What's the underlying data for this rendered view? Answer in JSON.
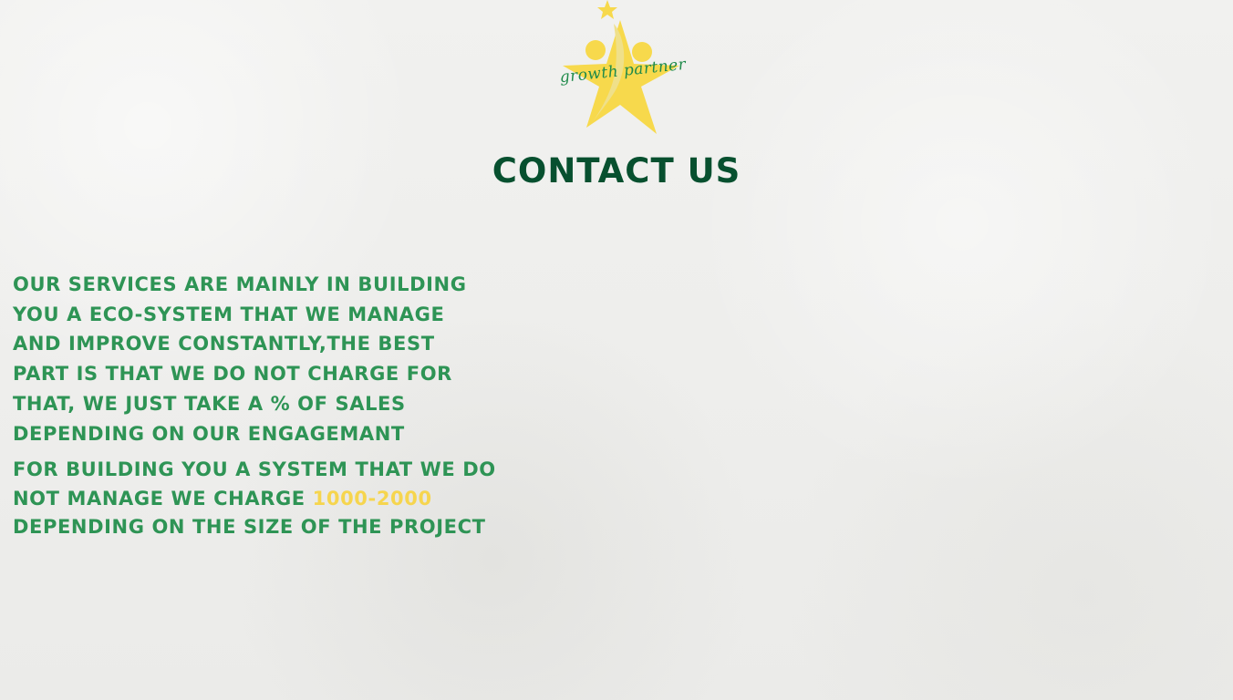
{
  "logo": {
    "text": "growth partner",
    "colors": {
      "star": "#f7d94c",
      "script": "#1f8a4a"
    }
  },
  "title": "CONTACT US",
  "paragraphs": [
    {
      "lines": [
        "OUR SERVICES ARE MAINLY IN BUILDING",
        "YOU A ECO-SYSTEM THAT WE MANAGE",
        "AND IMPROVE CONSTANTLY,THE BEST",
        "PART IS THAT WE DO NOT CHARGE FOR",
        "THAT, WE JUST TAKE A % OF SALES",
        "DEPENDING ON OUR ENGAGEMANT"
      ]
    },
    {
      "line1": "FOR BUILDING YOU A SYSTEM THAT WE DO",
      "line2_prefix": "NOT MANAGE WE CHARGE ",
      "price": "1000-2000",
      "line3": "DEPENDING ON THE SIZE OF THE PROJECT"
    }
  ],
  "colors": {
    "title": "#07502f",
    "body": "#2e9455",
    "price": "#f6d54e",
    "background": "#efefee"
  }
}
